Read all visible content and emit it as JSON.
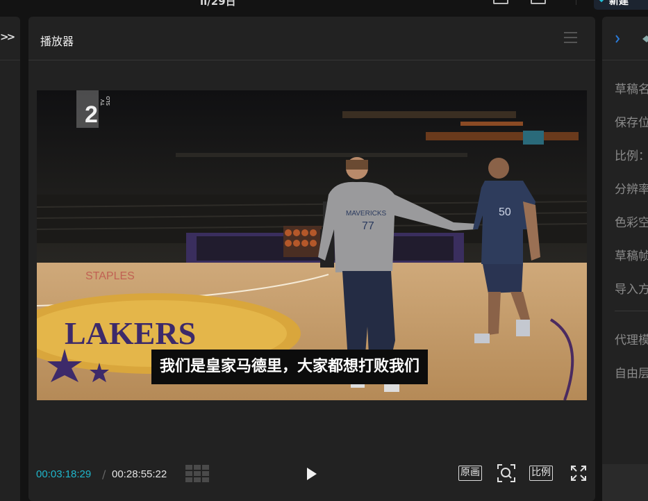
{
  "top": {
    "title": "il/29日",
    "new_button_label": "新建"
  },
  "left_panel": {
    "expand_label": ">>"
  },
  "player": {
    "title": "播放器",
    "subtitle": "我们是皇家马德里，大家都想打败我们",
    "channel_logo_number": "2",
    "channel_logo_text": "TV SLO",
    "current_time": "00:03:18:29",
    "separator": "/",
    "duration": "00:28:55:22",
    "original_label": "原画",
    "ratio_label": "比例"
  },
  "right_panel": {
    "items": [
      "草稿名",
      "保存位",
      "比例：",
      "分辨率",
      "色彩空",
      "草稿帧",
      "导入方",
      "代理模",
      "自由层"
    ]
  },
  "colors": {
    "accent": "#1fb6cc",
    "panel": "#222222",
    "background": "#131313"
  }
}
